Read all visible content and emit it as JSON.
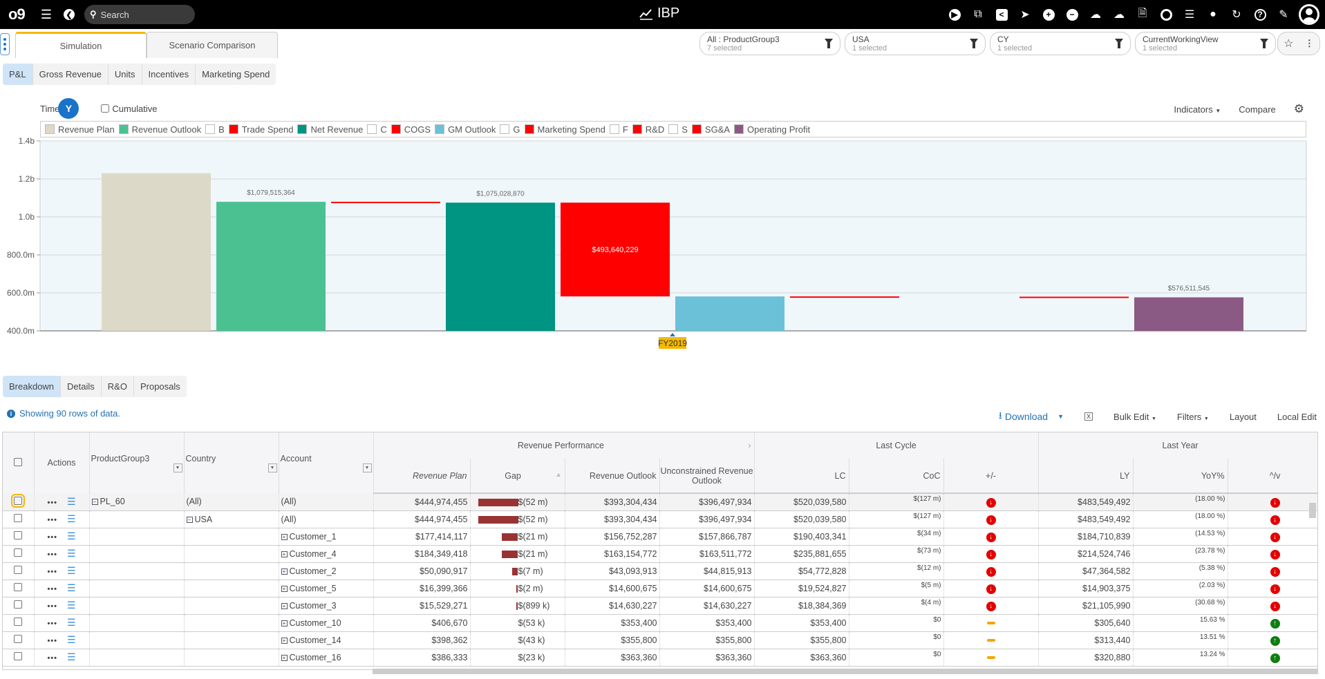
{
  "topbar": {
    "logo": "o9",
    "search_placeholder": "Search",
    "app_title": "IBP",
    "icons": [
      "play-icon",
      "copy-icon",
      "share-icon",
      "send-icon",
      "plus-circle-icon",
      "minus-circle-icon",
      "cloud-upload-icon",
      "cloud-download-icon",
      "pdf-icon",
      "target-icon",
      "list-icon",
      "comment-icon",
      "refresh-icon",
      "help-icon",
      "edit-icon",
      "user-avatar-icon"
    ]
  },
  "main_tabs": [
    {
      "label": "Simulation",
      "active": true
    },
    {
      "label": "Scenario Comparison",
      "active": false
    }
  ],
  "filters": [
    {
      "label": "All : ProductGroup3",
      "sub": "7 selected"
    },
    {
      "label": "USA",
      "sub": "1 selected"
    },
    {
      "label": "CY",
      "sub": "1 selected"
    },
    {
      "label": "CurrentWorkingView",
      "sub": "1 selected"
    }
  ],
  "sub_tabs": [
    {
      "label": "P&L",
      "active": true
    },
    {
      "label": "Gross Revenue"
    },
    {
      "label": "Units"
    },
    {
      "label": "Incentives"
    },
    {
      "label": "Marketing Spend"
    }
  ],
  "chart_controls": {
    "time_label": "Time",
    "time_level": "Y",
    "cumulative_label": "Cumulative",
    "indicators_label": "Indicators",
    "compare_label": "Compare"
  },
  "chart_data": {
    "type": "bar",
    "subtype": "waterfall",
    "title": "",
    "xlabel": "",
    "ylabel": "",
    "x_category": "FY2019",
    "ylim": [
      400000000,
      1400000000
    ],
    "y_ticks": [
      "400.0m",
      "600.0m",
      "800.0m",
      "1.0b",
      "1.2b",
      "1.4b"
    ],
    "y_tick_values": [
      400000000,
      600000000,
      800000000,
      1000000000,
      1200000000,
      1400000000
    ],
    "grid": true,
    "legend_position": "top",
    "legend": [
      {
        "name": "Revenue Plan",
        "color": "#dcd9c8"
      },
      {
        "name": "Revenue Outlook",
        "color": "#4bc192"
      },
      {
        "name": "B",
        "color": "#ffffff"
      },
      {
        "name": "Trade Spend",
        "color": "#ff0000"
      },
      {
        "name": "Net Revenue",
        "color": "#009482"
      },
      {
        "name": "C",
        "color": "#ffffff"
      },
      {
        "name": "COGS",
        "color": "#ff0000"
      },
      {
        "name": "GM Outlook",
        "color": "#6bc1d8"
      },
      {
        "name": "G",
        "color": "#ffffff"
      },
      {
        "name": "Marketing Spend",
        "color": "#ff0000"
      },
      {
        "name": "F",
        "color": "#ffffff"
      },
      {
        "name": "R&D",
        "color": "#ff0000"
      },
      {
        "name": "S",
        "color": "#ffffff"
      },
      {
        "name": "SG&A",
        "color": "#ff0000"
      },
      {
        "name": "Operating Profit",
        "color": "#8b5a84"
      }
    ],
    "series": [
      {
        "name": "Revenue Plan",
        "base": 0,
        "top": 1230000000,
        "label": "",
        "color": "#dcd9c8"
      },
      {
        "name": "Revenue Outlook",
        "base": 0,
        "top": 1079515364,
        "label": "$1,079,515,364",
        "color": "#4bc192"
      },
      {
        "name": "Trade Spend",
        "base": 1075028870,
        "top": 1079515364,
        "label": "",
        "color": "#ff0000"
      },
      {
        "name": "Net Revenue",
        "base": 0,
        "top": 1075028870,
        "label": "$1,075,028,870",
        "color": "#009482"
      },
      {
        "name": "COGS",
        "base": 581388641,
        "top": 1075028870,
        "label": "$493,640,229",
        "color": "#ff0000"
      },
      {
        "name": "GM Outlook",
        "base": 0,
        "top": 581388641,
        "label": "",
        "color": "#6bc1d8"
      },
      {
        "name": "Marketing Spend",
        "base": 580000000,
        "top": 581388641,
        "label": "",
        "color": "#ff0000"
      },
      {
        "name": "R&D",
        "base": 580000000,
        "top": 580000000,
        "label": "",
        "color": "#ff0000"
      },
      {
        "name": "SG&A",
        "base": 576511545,
        "top": 580000000,
        "label": "",
        "color": "#ff0000"
      },
      {
        "name": "Operating Profit",
        "base": 0,
        "top": 576511545,
        "label": "$576,511,545",
        "color": "#8b5a84"
      }
    ]
  },
  "bottom_tabs": [
    {
      "label": "Breakdown",
      "active": true
    },
    {
      "label": "Details"
    },
    {
      "label": "R&O"
    },
    {
      "label": "Proposals"
    }
  ],
  "grid_info": "Showing 90 rows of data.",
  "grid_tools": {
    "download": "Download",
    "bulk_edit": "Bulk Edit",
    "filters": "Filters",
    "layout": "Layout",
    "local_edit": "Local Edit"
  },
  "table": {
    "groups": {
      "revenue_performance": "Revenue Performance",
      "last_cycle": "Last Cycle",
      "last_year": "Last Year"
    },
    "columns": [
      "Actions",
      "ProductGroup3",
      "Country",
      "Account",
      "Revenue Plan",
      "Gap",
      "Revenue Outlook",
      "Unconstrained Revenue Outlook",
      "LC",
      "CoC",
      "+/-",
      "LY",
      "YoY%",
      "^/v"
    ],
    "rows": [
      {
        "pg": "PL_60",
        "pg_toggle": "minus",
        "country": "(All)",
        "country_toggle": "",
        "account": "(All)",
        "account_toggle": "",
        "plan": "$444,974,455",
        "gap": "$(52 m)",
        "gap_m": 52,
        "outlook": "$393,304,434",
        "unc": "$396,497,934",
        "lc": "$520,039,580",
        "coc": "$(127 m)",
        "pm": "down",
        "ly": "$483,549,492",
        "yoy": "(18.00 %)",
        "uv": "down"
      },
      {
        "pg": "",
        "pg_toggle": "",
        "country": "USA",
        "country_toggle": "minus",
        "account": "(All)",
        "account_toggle": "",
        "plan": "$444,974,455",
        "gap": "$(52 m)",
        "gap_m": 52,
        "outlook": "$393,304,434",
        "unc": "$396,497,934",
        "lc": "$520,039,580",
        "coc": "$(127 m)",
        "pm": "down",
        "ly": "$483,549,492",
        "yoy": "(18.00 %)",
        "uv": "down"
      },
      {
        "pg": "",
        "pg_toggle": "",
        "country": "",
        "country_toggle": "",
        "account": "Customer_1",
        "account_toggle": "plus",
        "plan": "$177,414,117",
        "gap": "$(21 m)",
        "gap_m": 21,
        "outlook": "$156,752,287",
        "unc": "$157,866,787",
        "lc": "$190,403,341",
        "coc": "$(34 m)",
        "pm": "down",
        "ly": "$184,710,839",
        "yoy": "(14.53 %)",
        "uv": "down"
      },
      {
        "pg": "",
        "pg_toggle": "",
        "country": "",
        "country_toggle": "",
        "account": "Customer_4",
        "account_toggle": "plus",
        "plan": "$184,349,418",
        "gap": "$(21 m)",
        "gap_m": 21,
        "outlook": "$163,154,772",
        "unc": "$163,511,772",
        "lc": "$235,881,655",
        "coc": "$(73 m)",
        "pm": "down",
        "ly": "$214,524,746",
        "yoy": "(23.78 %)",
        "uv": "down"
      },
      {
        "pg": "",
        "pg_toggle": "",
        "country": "",
        "country_toggle": "",
        "account": "Customer_2",
        "account_toggle": "plus",
        "plan": "$50,090,917",
        "gap": "$(7 m)",
        "gap_m": 7,
        "outlook": "$43,093,913",
        "unc": "$44,815,913",
        "lc": "$54,772,828",
        "coc": "$(12 m)",
        "pm": "down",
        "ly": "$47,364,582",
        "yoy": "(5.38 %)",
        "uv": "down"
      },
      {
        "pg": "",
        "pg_toggle": "",
        "country": "",
        "country_toggle": "",
        "account": "Customer_5",
        "account_toggle": "plus",
        "plan": "$16,399,366",
        "gap": "$(2 m)",
        "gap_m": 2,
        "outlook": "$14,600,675",
        "unc": "$14,600,675",
        "lc": "$19,524,827",
        "coc": "$(5 m)",
        "pm": "down",
        "ly": "$14,903,375",
        "yoy": "(2.03 %)",
        "uv": "down"
      },
      {
        "pg": "",
        "pg_toggle": "",
        "country": "",
        "country_toggle": "",
        "account": "Customer_3",
        "account_toggle": "plus",
        "plan": "$15,529,271",
        "gap": "$(899 k)",
        "gap_m": 0.9,
        "outlook": "$14,630,227",
        "unc": "$14,630,227",
        "lc": "$18,384,369",
        "coc": "$(4 m)",
        "pm": "down",
        "ly": "$21,105,990",
        "yoy": "(30.68 %)",
        "uv": "down"
      },
      {
        "pg": "",
        "pg_toggle": "",
        "country": "",
        "country_toggle": "",
        "account": "Customer_10",
        "account_toggle": "plus",
        "plan": "$406,670",
        "gap": "$(53 k)",
        "gap_m": 0,
        "outlook": "$353,400",
        "unc": "$353,400",
        "lc": "$353,400",
        "coc": "$0",
        "pm": "flat",
        "ly": "$305,640",
        "yoy": "15.63 %",
        "uv": "up"
      },
      {
        "pg": "",
        "pg_toggle": "",
        "country": "",
        "country_toggle": "",
        "account": "Customer_14",
        "account_toggle": "plus",
        "plan": "$398,362",
        "gap": "$(43 k)",
        "gap_m": 0,
        "outlook": "$355,800",
        "unc": "$355,800",
        "lc": "$355,800",
        "coc": "$0",
        "pm": "flat",
        "ly": "$313,440",
        "yoy": "13.51 %",
        "uv": "up"
      },
      {
        "pg": "",
        "pg_toggle": "",
        "country": "",
        "country_toggle": "",
        "account": "Customer_16",
        "account_toggle": "plus",
        "plan": "$386,333",
        "gap": "$(23 k)",
        "gap_m": 0,
        "outlook": "$363,360",
        "unc": "$363,360",
        "lc": "$363,360",
        "coc": "$0",
        "pm": "flat",
        "ly": "$320,880",
        "yoy": "13.24 %",
        "uv": "up"
      }
    ]
  }
}
